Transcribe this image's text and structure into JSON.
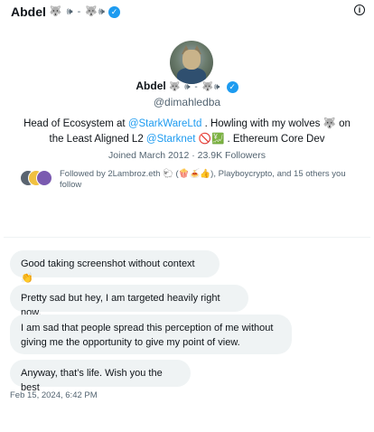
{
  "header": {
    "name": "Abdel",
    "emoji": "🐺 🕪 - 🐺🕪",
    "info_icon": "info-icon"
  },
  "profile": {
    "name": "Abdel",
    "emoji": "🐺 🕪 - 🐺🕪",
    "handle": "@dimahledba",
    "bio_pre": "Head of Ecosystem at ",
    "bio_link1": "@StarkWareLtd",
    "bio_mid": " . Howling with my wolves 🐺 on the Least Aligned L2 ",
    "bio_link2": "@Starknet",
    "bio_post": " 🚫💹 . Ethereum Core Dev",
    "joined": "Joined March 2012 · 23.9K Followers",
    "followed_by": "Followed by 2Lambroz.eth 🐑 (🍿🍝👍), Playboycrypto, and 15 others you follow"
  },
  "messages": [
    "Good taking screenshot without context 👏",
    "Pretty sad but hey, I am targeted heavily right now.",
    "I am sad that people spread this perception of me without giving me the opportunity to give my point of view.",
    "Anyway, that’s life. Wish you the best"
  ],
  "timestamp": "Feb 15, 2024, 6:42 PM",
  "colors": {
    "accent": "#1d9bf0",
    "bubble": "#eff3f4",
    "muted": "#536471"
  }
}
